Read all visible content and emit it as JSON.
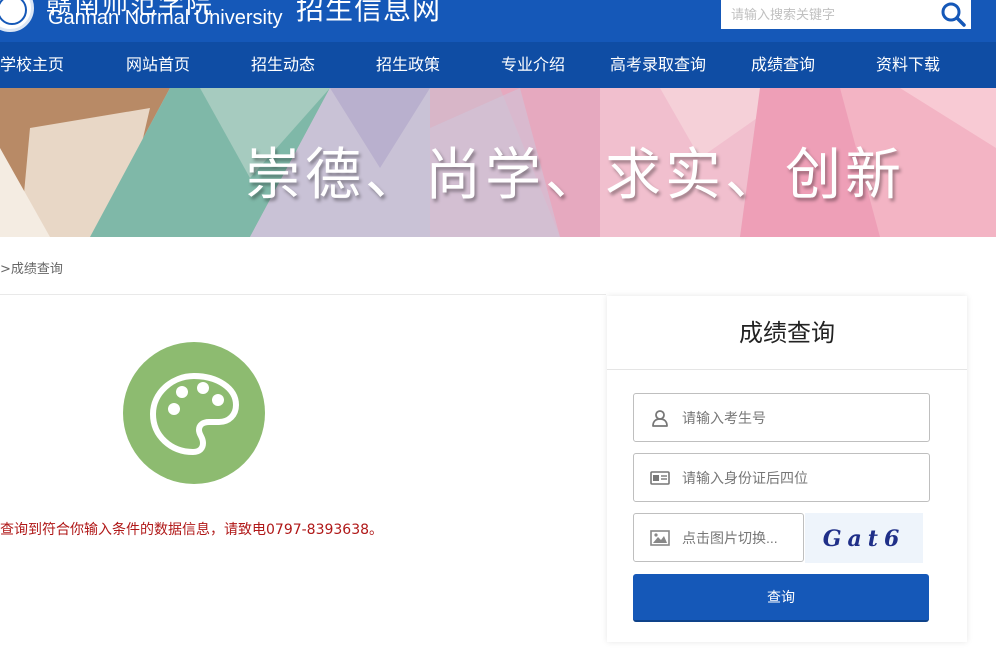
{
  "header": {
    "logo_cn_fragment": "赣南师范学院",
    "logo_en": "Gannan Normal University",
    "site_title": "招生信息网",
    "search_placeholder": "请输入搜索关键字",
    "brand_color": "#1558b8",
    "nav_color": "#0f4da4"
  },
  "nav": {
    "items": [
      {
        "label": "学校主页"
      },
      {
        "label": "网站首页"
      },
      {
        "label": "招生动态"
      },
      {
        "label": "招生政策"
      },
      {
        "label": "专业介绍"
      },
      {
        "label": "高考录取查询"
      },
      {
        "label": "成绩查询"
      },
      {
        "label": "资料下载"
      }
    ]
  },
  "banner": {
    "motto": "崇德、尚学、求实、创新"
  },
  "breadcrumb": {
    "text": ">成绩查询"
  },
  "result": {
    "icon": "palette-icon",
    "message": "查询到符合你输入条件的数据信息，请致电0797-8393638。",
    "message_color": "#b01818"
  },
  "query_panel": {
    "title": "成绩查询",
    "exam_no_placeholder": "请输入考生号",
    "id_last4_placeholder": "请输入身份证后四位",
    "captcha_placeholder": "点击图片切换...",
    "captcha_image_text": "Gat6",
    "submit_label": "查询",
    "icons": [
      "user-icon",
      "id-card-icon",
      "image-icon"
    ]
  }
}
